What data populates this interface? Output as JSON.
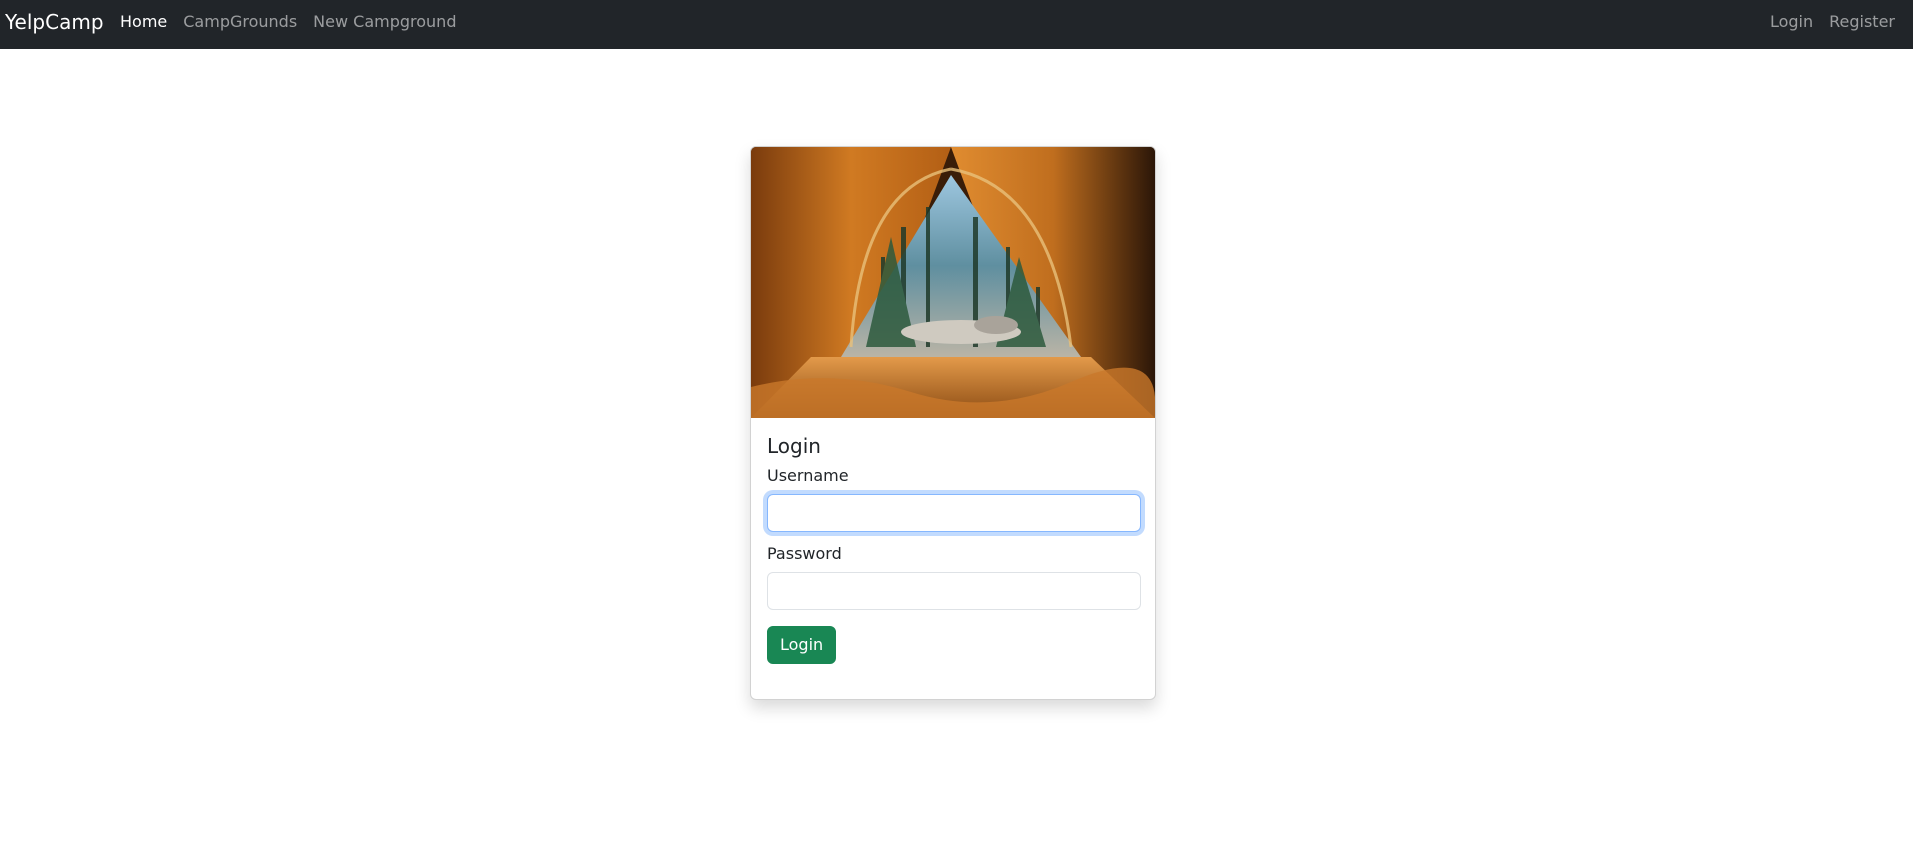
{
  "navbar": {
    "brand": "YelpCamp",
    "links": [
      {
        "label": "Home",
        "active": true
      },
      {
        "label": "CampGrounds",
        "active": false
      },
      {
        "label": "New Campground",
        "active": false
      }
    ],
    "right_links": [
      {
        "label": "Login"
      },
      {
        "label": "Register"
      }
    ]
  },
  "card": {
    "image_alt": "tent-view-image",
    "title": "Login",
    "username_label": "Username",
    "username_value": "",
    "password_label": "Password",
    "password_value": "",
    "submit_label": "Login"
  },
  "colors": {
    "navbar_bg": "#212529",
    "success": "#198754",
    "focus_border": "#86b7fe"
  }
}
